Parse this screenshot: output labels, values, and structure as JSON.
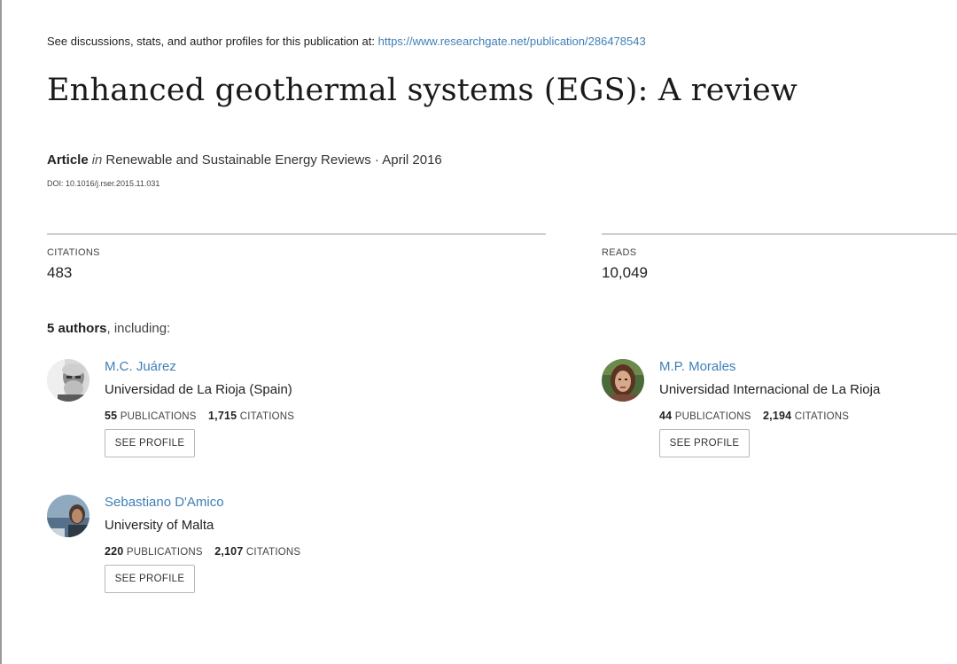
{
  "header": {
    "source_prefix": "See discussions, stats, and author profiles for this publication at:",
    "source_url": "https://www.researchgate.net/publication/286478543"
  },
  "publication": {
    "title": "Enhanced geothermal systems (EGS): A review",
    "type": "Article",
    "in_word": "in",
    "journal_date": "Renewable and Sustainable Energy Reviews · April 2016",
    "doi": "DOI: 10.1016/j.rser.2015.11.031"
  },
  "stats": {
    "citations_label": "CITATIONS",
    "citations_value": "483",
    "reads_label": "READS",
    "reads_value": "10,049"
  },
  "authors_heading": {
    "count": "5 authors",
    "suffix": ", including:"
  },
  "authors": [
    {
      "name": "M.C. Juárez",
      "institution": "Universidad de La Rioja (Spain)",
      "publications": "55",
      "publications_label": "PUBLICATIONS",
      "citations": "1,715",
      "citations_label": "CITATIONS",
      "button": "SEE PROFILE"
    },
    {
      "name": "M.P. Morales",
      "institution": "Universidad Internacional de La Rioja",
      "publications": "44",
      "publications_label": "PUBLICATIONS",
      "citations": "2,194",
      "citations_label": "CITATIONS",
      "button": "SEE PROFILE"
    },
    {
      "name": "Sebastiano D'Amico",
      "institution": "University of Malta",
      "publications": "220",
      "publications_label": "PUBLICATIONS",
      "citations": "2,107",
      "citations_label": "CITATIONS",
      "button": "SEE PROFILE"
    }
  ],
  "colors": {
    "link": "#3f7fb5",
    "text": "#222222",
    "rule": "#cfcfcf"
  }
}
